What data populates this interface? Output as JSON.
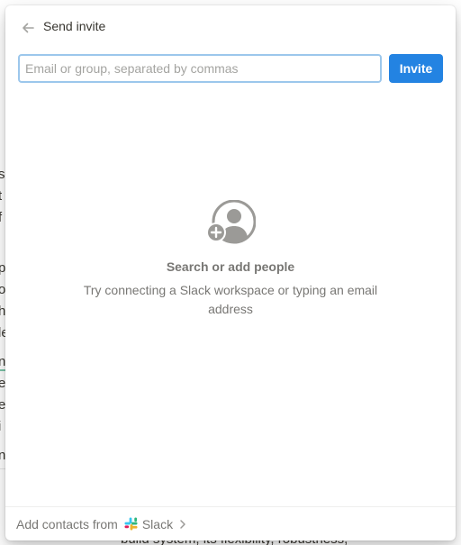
{
  "background": {
    "left_fragments": [
      "s",
      "t",
      "f",
      "p",
      "or",
      "he",
      "le",
      "n",
      "e",
      "e",
      "i",
      "n"
    ],
    "bottom_text": "build system, its flexibility, robustness,"
  },
  "panel": {
    "title": "Send invite",
    "back_icon": "arrow-left-icon",
    "input": {
      "value": "",
      "placeholder": "Email or group, separated by commas"
    },
    "invite_label": "Invite",
    "empty_state": {
      "icon": "add-person-icon",
      "title": "Search or add people",
      "description": "Try connecting a Slack workspace or typing an email address"
    },
    "footer": {
      "prefix": "Add contacts from",
      "service": "Slack",
      "service_icon": "slack-logo",
      "chevron_icon": "chevron-right-icon"
    }
  },
  "colors": {
    "accent": "#2383e2",
    "input_focus_border": "#9cc7ec",
    "muted_text": "#787774",
    "primary_text": "#37352f"
  }
}
